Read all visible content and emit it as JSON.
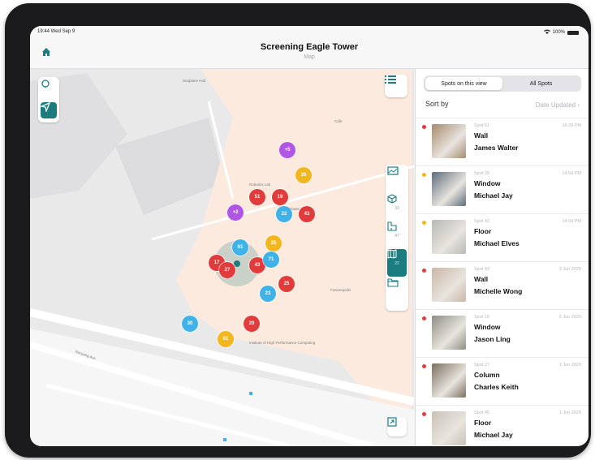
{
  "status": {
    "time": "19:44  Wed Sep 9",
    "battery": "100%"
  },
  "header": {
    "title": "Screening Eagle Tower",
    "subtitle": "Map"
  },
  "map": {
    "markers": [
      {
        "label": "+5",
        "color": "#b055e6"
      },
      {
        "label": "26",
        "color": "#f2b71e"
      },
      {
        "label": "51",
        "color": "#e23b3b"
      },
      {
        "label": "19",
        "color": "#e23b3b"
      },
      {
        "label": "+2",
        "color": "#b055e6"
      },
      {
        "label": "22",
        "color": "#3fb3e8"
      },
      {
        "label": "43",
        "color": "#e23b3b"
      },
      {
        "label": "61",
        "color": "#3fb3e8"
      },
      {
        "label": "35",
        "color": "#f2b71e"
      },
      {
        "label": "17",
        "color": "#e23b3b"
      },
      {
        "label": "27",
        "color": "#e23b3b"
      },
      {
        "label": "43",
        "color": "#e23b3b"
      },
      {
        "label": "71",
        "color": "#3fb3e8"
      },
      {
        "label": "23",
        "color": "#3fb3e8"
      },
      {
        "label": "25",
        "color": "#e23b3b"
      },
      {
        "label": "30",
        "color": "#3fb3e8"
      },
      {
        "label": "20",
        "color": "#e23b3b"
      },
      {
        "label": "61",
        "color": "#f2b71e"
      }
    ],
    "poi_labels": [
      "Seaplane Hub",
      "Cafe",
      "Robotics Lab",
      "Tower Annex",
      "Institute of High Performance Computing",
      "Fusionopolis",
      "Nanyang Ave"
    ],
    "layers": [
      {
        "name": "chart-layer",
        "count": ""
      },
      {
        "name": "cube-layer",
        "count": "33"
      },
      {
        "name": "floorplan-layer",
        "count": "47"
      },
      {
        "name": "map-layer",
        "count": "22"
      },
      {
        "name": "folder-layer",
        "count": ""
      }
    ]
  },
  "panel": {
    "segment": {
      "selected": "Spots on this view",
      "other": "All Spots"
    },
    "sort": {
      "label": "Sort by",
      "value": "Date Updated"
    },
    "spots": [
      {
        "no": "Spot 51",
        "type": "Wall",
        "person": "James Walter",
        "time": "16:39 PM",
        "status": "#e23b3b",
        "thumb": "#a58b6e"
      },
      {
        "no": "Spot 39",
        "type": "Window",
        "person": "Michael Jay",
        "time": "14:54 PM",
        "status": "#f2b71e",
        "thumb": "#5d6c7a"
      },
      {
        "no": "Spot 42",
        "type": "Floor",
        "person": "Michael Elves",
        "time": "14:54 PM",
        "status": "#f2b71e",
        "thumb": "#b8b8b4"
      },
      {
        "no": "Spot 43",
        "type": "Wall",
        "person": "Michelle Wong",
        "time": "3 Jun 2020",
        "status": "#e23b3b",
        "thumb": "#c8b7a6"
      },
      {
        "no": "Spot 16",
        "type": "Window",
        "person": "Jason Ling",
        "time": "2 Jun 2020",
        "status": "#e23b3b",
        "thumb": "#8f8d86"
      },
      {
        "no": "Spot 27",
        "type": "Column",
        "person": "Charles Keith",
        "time": "1 Jun 2020",
        "status": "#e23b3b",
        "thumb": "#7b6f5e"
      },
      {
        "no": "Spot 45",
        "type": "Floor",
        "person": "Michael Jay",
        "time": "1 Jun 2020",
        "status": "#e23b3b",
        "thumb": "#c9c2b8"
      }
    ]
  },
  "colors": {
    "accent": "#1b7c80",
    "red": "#e23b3b",
    "yellow": "#f2b71e",
    "blue": "#3fb3e8",
    "purple": "#b055e6"
  }
}
